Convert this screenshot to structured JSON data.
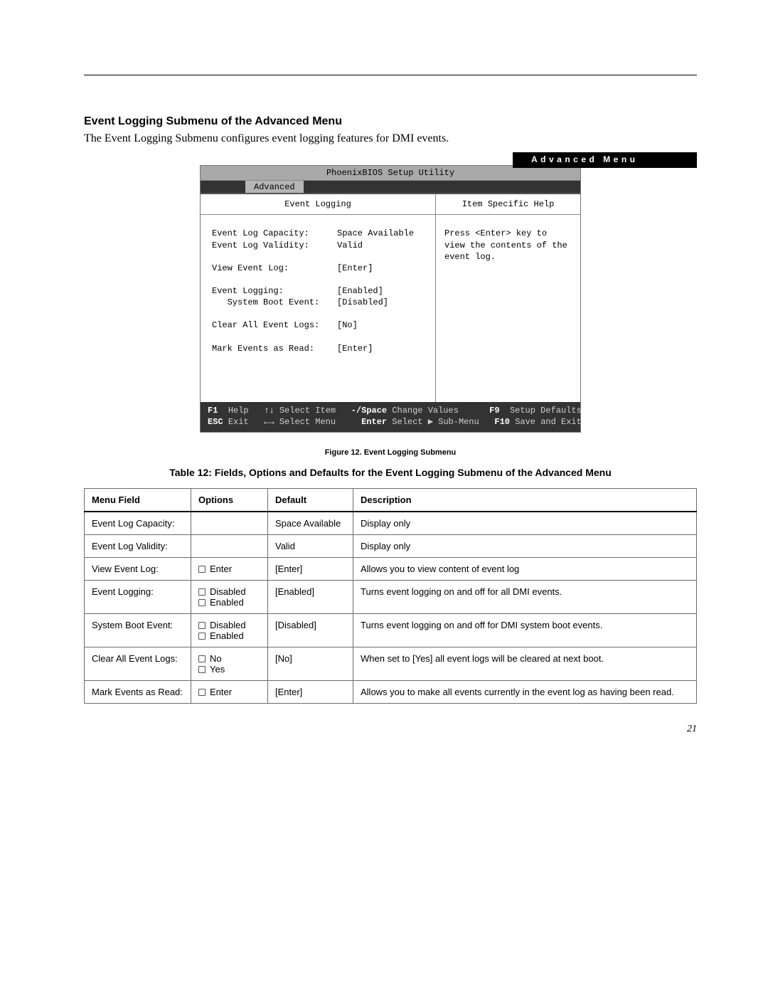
{
  "header_bar": "Advanced Menu",
  "section_title": "Event Logging Submenu of the Advanced Menu",
  "intro_text": "The Event Logging Submenu configures event logging features for DMI events.",
  "bios": {
    "title": "PhoenixBIOS Setup Utility",
    "active_tab": "Advanced",
    "left_heading": "Event Logging",
    "right_heading": "Item Specific Help",
    "help_text": "Press <Enter> key to view the contents of the event log.",
    "fields": {
      "capacity_label": "Event Log Capacity:",
      "capacity_value": "Space Available",
      "validity_label": "Event Log Validity:",
      "validity_value": "Valid",
      "view_label": "View Event Log:",
      "view_value": "[Enter]",
      "logging_label": "Event Logging:",
      "logging_value": "[Enabled]",
      "boot_label_indent": "   System Boot Event:",
      "boot_value": "[Disabled]",
      "clear_label": "Clear All Event Logs:",
      "clear_value": "[No]",
      "mark_label": "Mark Events as Read:",
      "mark_value": "[Enter]"
    },
    "footer": {
      "row1_key1": "F1",
      "row1_lbl1": "Help",
      "row1_key2": "↑↓",
      "row1_lbl2": "Select Item",
      "row1_key3": "-/Space",
      "row1_lbl3": "Change Values",
      "row1_key4": "F9",
      "row1_lbl4": "Setup Defaults",
      "row2_key1": "ESC",
      "row2_lbl1": "Exit",
      "row2_key2": "←→",
      "row2_lbl2": "Select Menu",
      "row2_key3": "Enter",
      "row2_lbl3_a": "Select",
      "row2_lbl3_b": "Sub-Menu",
      "row2_key4": "F10",
      "row2_lbl4": "Save and Exit"
    }
  },
  "figure_caption": "Figure 12.  Event Logging Submenu",
  "table_caption": "Table 12: Fields, Options and Defaults for the Event Logging Submenu of the Advanced Menu",
  "table": {
    "headers": {
      "menu_field": "Menu Field",
      "options": "Options",
      "default": "Default",
      "description": "Description"
    },
    "rows": [
      {
        "field": "Event Log Capacity:",
        "options": [],
        "default": "Space Available",
        "desc": "Display only"
      },
      {
        "field": "Event Log Validity:",
        "options": [],
        "default": "Valid",
        "desc": "Display only"
      },
      {
        "field": "View Event Log:",
        "options": [
          "Enter"
        ],
        "default": "[Enter]",
        "desc": "Allows you to view content of event log"
      },
      {
        "field": "Event Logging:",
        "options": [
          "Disabled",
          "Enabled"
        ],
        "default": "[Enabled]",
        "desc": "Turns event logging on and off for all DMI events."
      },
      {
        "field": "System Boot Event:",
        "options": [
          "Disabled",
          "Enabled"
        ],
        "default": "[Disabled]",
        "desc": "Turns event logging on and off for DMI system boot events."
      },
      {
        "field": "Clear All Event Logs:",
        "options": [
          "No",
          "Yes"
        ],
        "default": "[No]",
        "desc": "When set to [Yes] all event logs will be cleared at next boot."
      },
      {
        "field": "Mark Events as Read:",
        "options": [
          "Enter"
        ],
        "default": "[Enter]",
        "desc": "Allows you to make all events currently in the event log as having been read."
      }
    ]
  },
  "page_number": "21"
}
